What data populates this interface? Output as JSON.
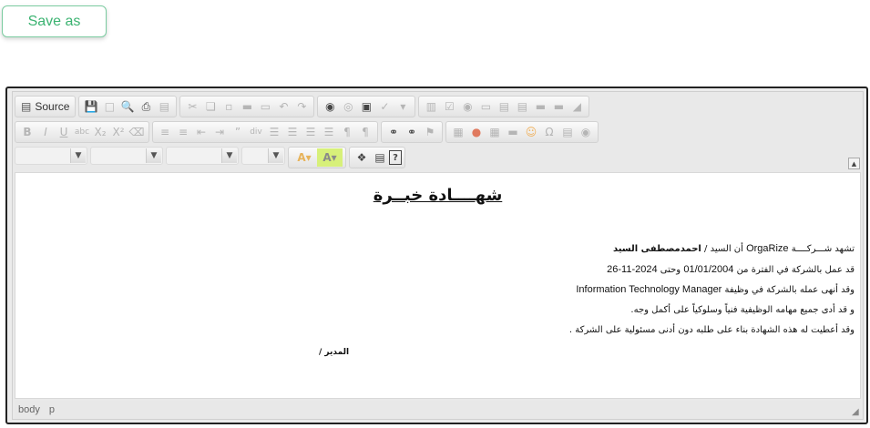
{
  "save_button": {
    "label": "Save as"
  },
  "toolbar": {
    "source_label": "Source",
    "row1": [
      [
        "save-icon",
        "new-page-icon",
        "preview-icon",
        "print-icon"
      ],
      [
        "templates-icon"
      ],
      [
        "cut-icon",
        "copy-icon",
        "paste-icon",
        "paste-text-icon",
        "paste-word-icon"
      ],
      [
        "undo-icon",
        "redo-icon"
      ],
      [
        "find-icon",
        "replace-icon"
      ],
      [
        "select-all-icon"
      ],
      [
        "spellcheck-icon",
        "scayt-icon"
      ],
      [
        "form-icon",
        "checkbox-icon",
        "radio-icon",
        "textfield-icon",
        "textarea-icon",
        "select-icon",
        "button-icon",
        "imagebutton-icon",
        "hiddenfield-icon"
      ]
    ],
    "row2": [
      [
        "bold-icon",
        "italic-icon",
        "underline-icon",
        "strike-icon",
        "subscript-icon",
        "superscript-icon"
      ],
      [
        "remove-format-icon"
      ],
      [
        "numbered-list-icon",
        "bulleted-list-icon"
      ],
      [
        "outdent-icon",
        "indent-icon"
      ],
      [
        "blockquote-icon",
        "creatediv-icon"
      ],
      [
        "align-left-icon",
        "align-center-icon",
        "align-right-icon",
        "justify-icon"
      ],
      [
        "ltr-icon",
        "rtl-icon"
      ],
      [
        "link-icon",
        "unlink-icon",
        "anchor-icon"
      ],
      [
        "image-icon",
        "flash-icon",
        "table-icon",
        "hr-icon",
        "smiley-icon",
        "special-char-icon",
        "pagebreak-icon",
        "iframe-icon"
      ]
    ],
    "row3_icons": [
      "text-color-icon",
      "bg-color-icon",
      "maximize-icon",
      "show-blocks-icon",
      "help-icon"
    ]
  },
  "document": {
    "title": "شهــــادة خبــرة",
    "lines": [
      {
        "parts": [
          "تشهد شـــركــــة  ",
          "OrgaRize",
          "  أن السيد / ",
          "احمدمصطفى السيد"
        ]
      },
      {
        "parts": [
          "قد عمل بالشركة في الفترة من ",
          "01/01/2004",
          "  وحتى ",
          "2024-11-26"
        ]
      },
      {
        "parts": [
          "وقد أنهى عمله بالشركة في وظيفة ",
          "Information Technology Manager"
        ]
      },
      {
        "parts": [
          "و قد أدى جميع مهامه الوظيفية فنياً وسلوكياً على أكمل وجه."
        ]
      },
      {
        "parts": [
          "وقد أعطيت له هذه الشهادة بناء على طلبه دون أدنى مسئولية على الشركة ."
        ]
      }
    ],
    "signature": "المدير /"
  },
  "statusbar": {
    "path": [
      "body",
      "p"
    ]
  }
}
